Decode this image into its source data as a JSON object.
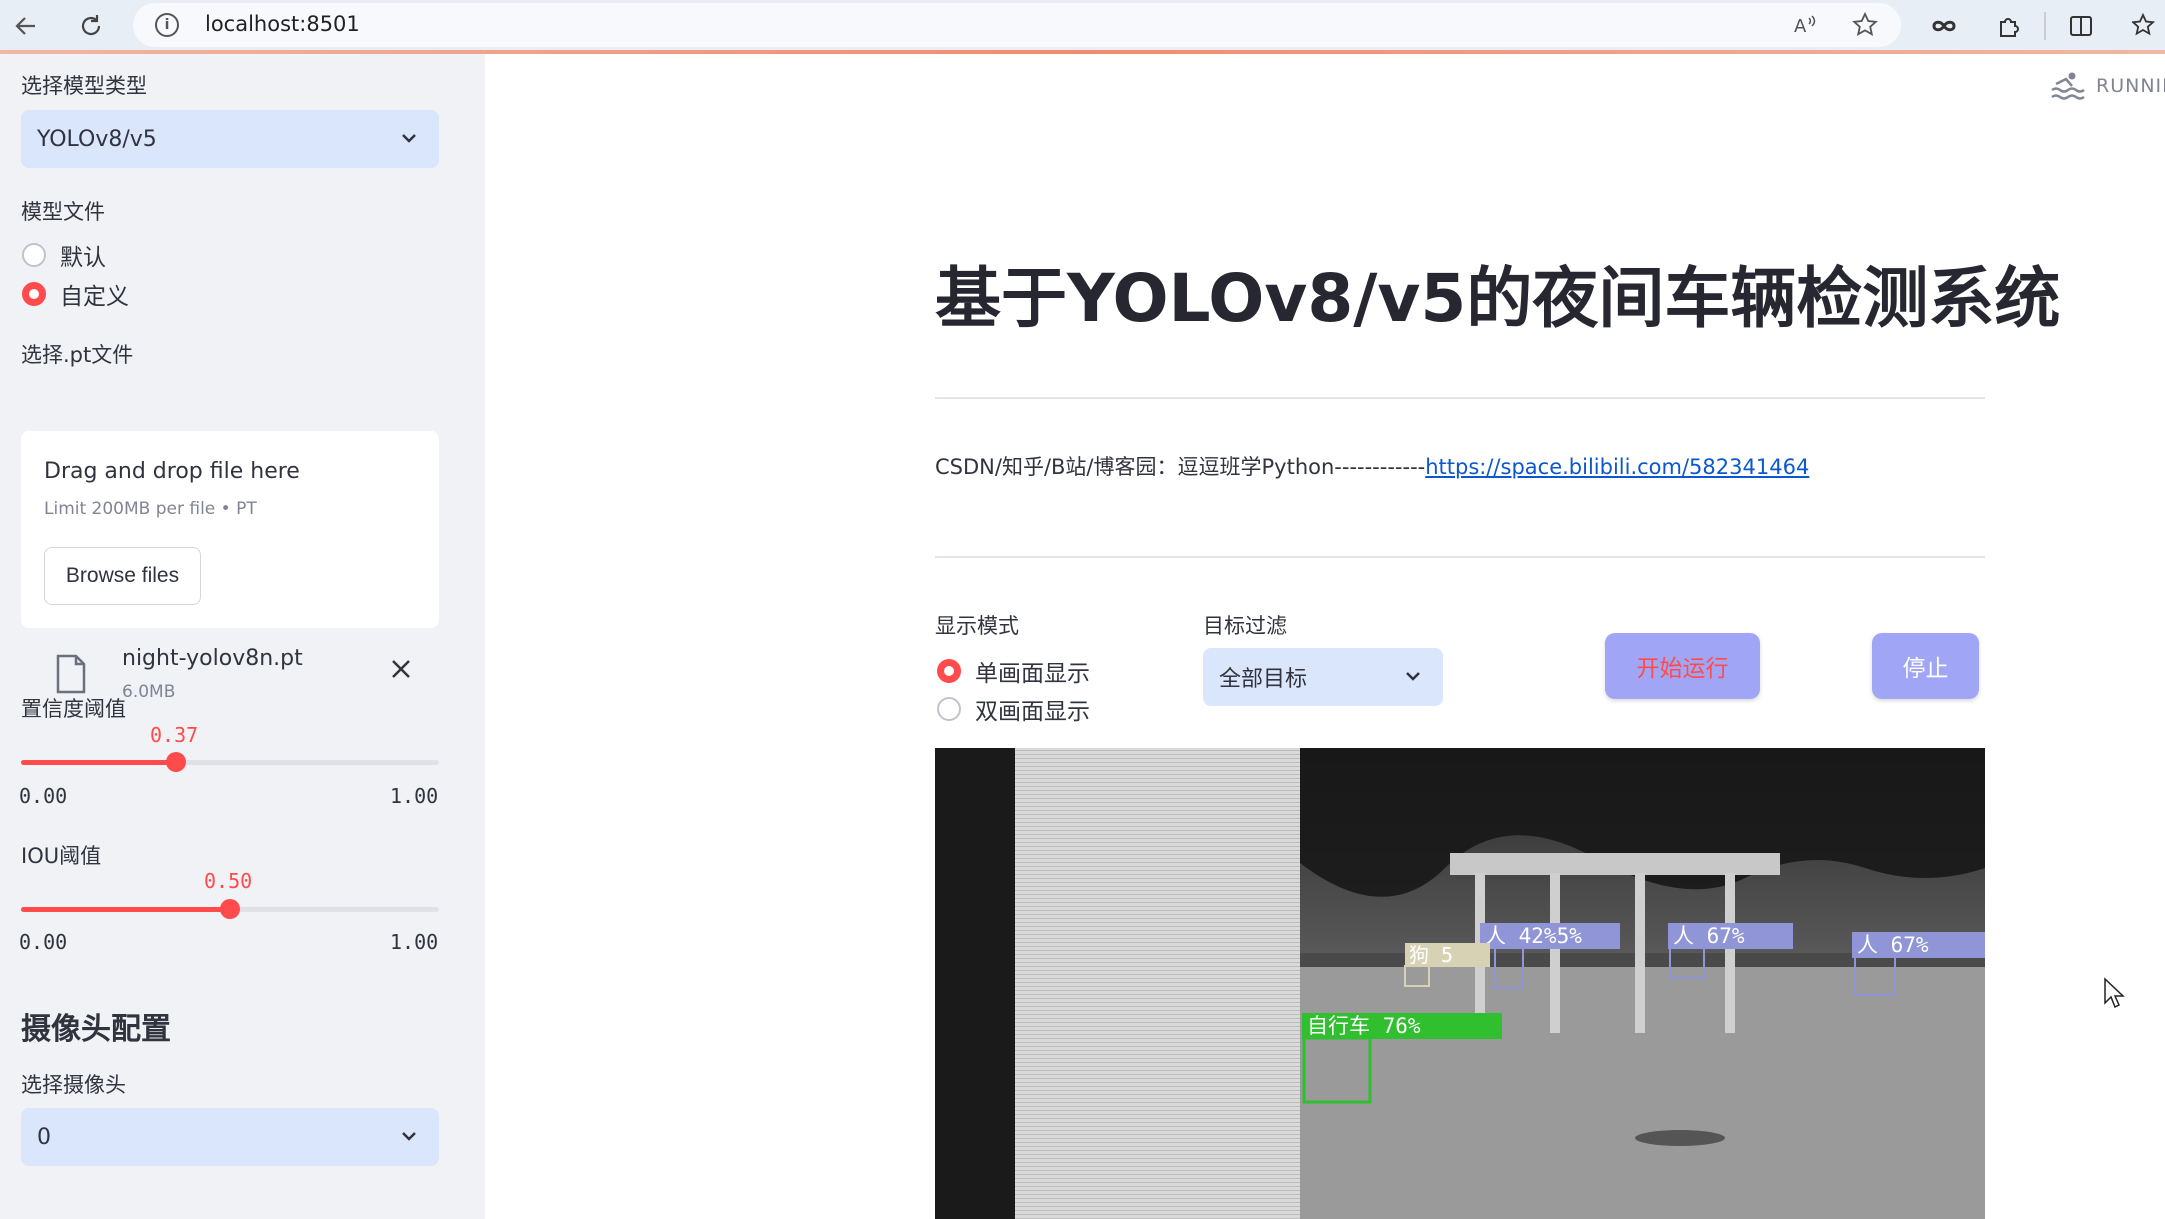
{
  "browser": {
    "url": "localhost:8501",
    "icons": [
      "back-icon",
      "refresh-icon",
      "info-icon",
      "read-aloud-icon",
      "favorite-star-icon",
      "infinity-icon",
      "extensions-icon",
      "split-screen-icon",
      "favorites-icon"
    ]
  },
  "sidebar": {
    "model_type_label": "选择模型类型",
    "model_type_value": "YOLOv8/v5",
    "model_file_label": "模型文件",
    "model_file_options": [
      "默认",
      "自定义"
    ],
    "model_file_selected": "自定义",
    "pt_file_label": "选择.pt文件",
    "uploader": {
      "drag_text": "Drag and drop file here",
      "limit_text": "Limit 200MB per file • PT",
      "browse_label": "Browse files"
    },
    "uploaded_file": {
      "name": "night-yolov8n.pt",
      "size": "6.0MB"
    },
    "confidence": {
      "label": "置信度阈值",
      "value": "0.37",
      "min": "0.00",
      "max": "1.00",
      "fraction": 0.37
    },
    "iou": {
      "label": "IOU阈值",
      "value": "0.50",
      "min": "0.00",
      "max": "1.00",
      "fraction": 0.5
    },
    "camera_section_title": "摄像头配置",
    "camera_label": "选择摄像头",
    "camera_value": "0"
  },
  "main": {
    "status": "RUNNIN",
    "title": "基于YOLOv8/v5的夜间车辆检测系统",
    "info_prefix": "CSDN/知乎/B站/博客园：逗逗班学Python------------",
    "info_link": "https://space.bilibili.com/582341464",
    "display_mode_label": "显示模式",
    "display_mode_options": [
      "单画面显示",
      "双画面显示"
    ],
    "display_mode_selected": "单画面显示",
    "target_filter_label": "目标过滤",
    "target_filter_value": "全部目标",
    "start_button": "开始运行",
    "stop_button": "停止",
    "detections": [
      {
        "label": "人 42%5%"
      },
      {
        "label": "人 67%"
      },
      {
        "label": "人 67%"
      },
      {
        "label": "狗 5"
      },
      {
        "label": "自行车 76%"
      }
    ]
  },
  "colors": {
    "accent": "#ff4b4b",
    "select_bg": "#d9e6fb",
    "button_bg": "#a0a6f5",
    "sidebar_bg": "#f0f2f6",
    "link": "#0b57d0",
    "detection_person": "#6f78c8",
    "detection_bicycle": "#2fbf2f"
  }
}
